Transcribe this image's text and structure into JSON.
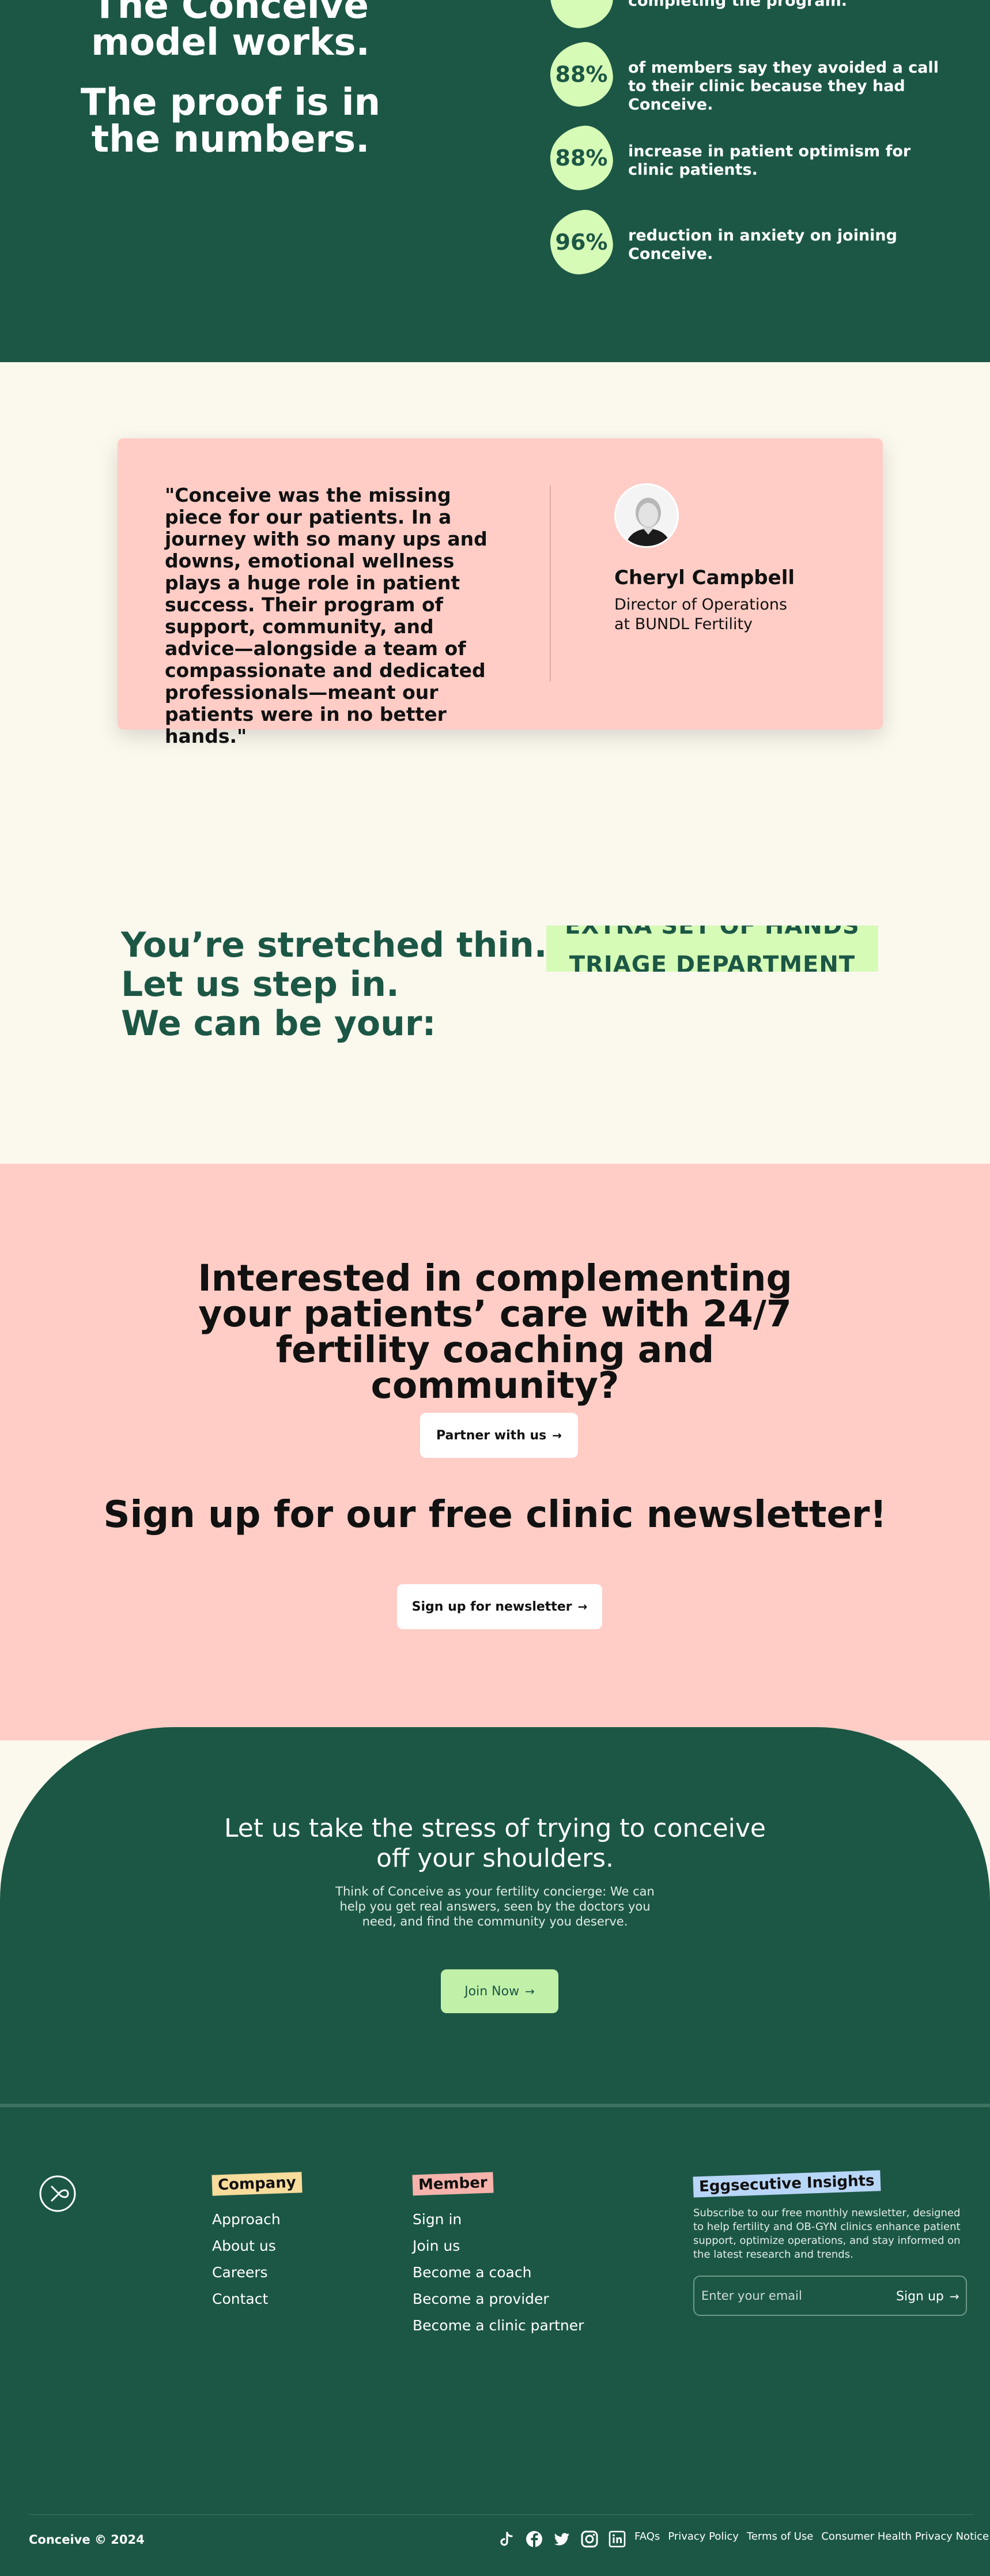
{
  "colors": {
    "dark_green": "#1c5745",
    "light_green": "#d6fbb7",
    "pink": "#ffcdc6",
    "cream": "#fbf8ee"
  },
  "stats": {
    "headline_1": "The Conceive model works.",
    "headline_2": "The proof is in the numbers.",
    "items": [
      {
        "value": "",
        "text": "completing the program."
      },
      {
        "value": "88%",
        "text": "of members say they avoided a call to their clinic because they had Conceive."
      },
      {
        "value": "88%",
        "text": "increase in patient optimism for clinic patients."
      },
      {
        "value": "96%",
        "text": "reduction in anxiety on joining Conceive."
      }
    ]
  },
  "testimonial": {
    "quote": "\"Conceive was the missing piece for our patients. In a journey with so many ups and downs, emotional wellness plays a huge role in patient success. Their program of support, community, and advice—alongside a team of compassionate and dedicated professionals—meant our patients were in no better hands.\"",
    "name": "Cheryl Campbell",
    "role": "Director of Operations at BUNDL Fertility"
  },
  "stretched": {
    "line_1": "You’re stretched thin.",
    "line_2": "Let us step in.",
    "line_3": "We can be your:",
    "ticker": [
      "EXTRA SET OF HANDS",
      "TRIAGE DEPARTMENT"
    ]
  },
  "cta": {
    "title": "Interested in complementing your patients’ care with 24/7 fertility coaching and community?",
    "partner_label": "Partner with us",
    "newsletter_title": "Sign up for our free clinic newsletter!",
    "newsletter_label": "Sign up for newsletter",
    "arrow": "→"
  },
  "arch": {
    "title": "Let us take the stress of trying to conceive off your shoulders.",
    "subtitle": "Think of Conceive as your fertility concierge: We can help you get real answers, seen by the doctors you need, and find the community you deserve.",
    "join_label": "Join Now"
  },
  "footer": {
    "company_title": "Company",
    "company_links": [
      "Approach",
      "About us",
      "Careers",
      "Contact"
    ],
    "member_title": "Member",
    "member_links": [
      "Sign in",
      "Join us",
      "Become a coach",
      "Become a provider",
      "Become a clinic partner"
    ],
    "eggs_title": "Eggsecutive Insights",
    "eggs_desc": "Subscribe to our free monthly newsletter, designed to help fertility and OB-GYN clinics enhance patient support, optimize operations, and stay informed on the latest research and trends.",
    "email_placeholder": "Enter your email",
    "signup_label": "Sign up",
    "copyright": "Conceive © 2024",
    "socials": [
      "tiktok-icon",
      "facebook-icon",
      "twitter-icon",
      "instagram-icon",
      "linkedin-icon"
    ],
    "legal_links": [
      "FAQs",
      "Privacy Policy",
      "Terms of Use",
      "Consumer Health Privacy Notice"
    ]
  }
}
